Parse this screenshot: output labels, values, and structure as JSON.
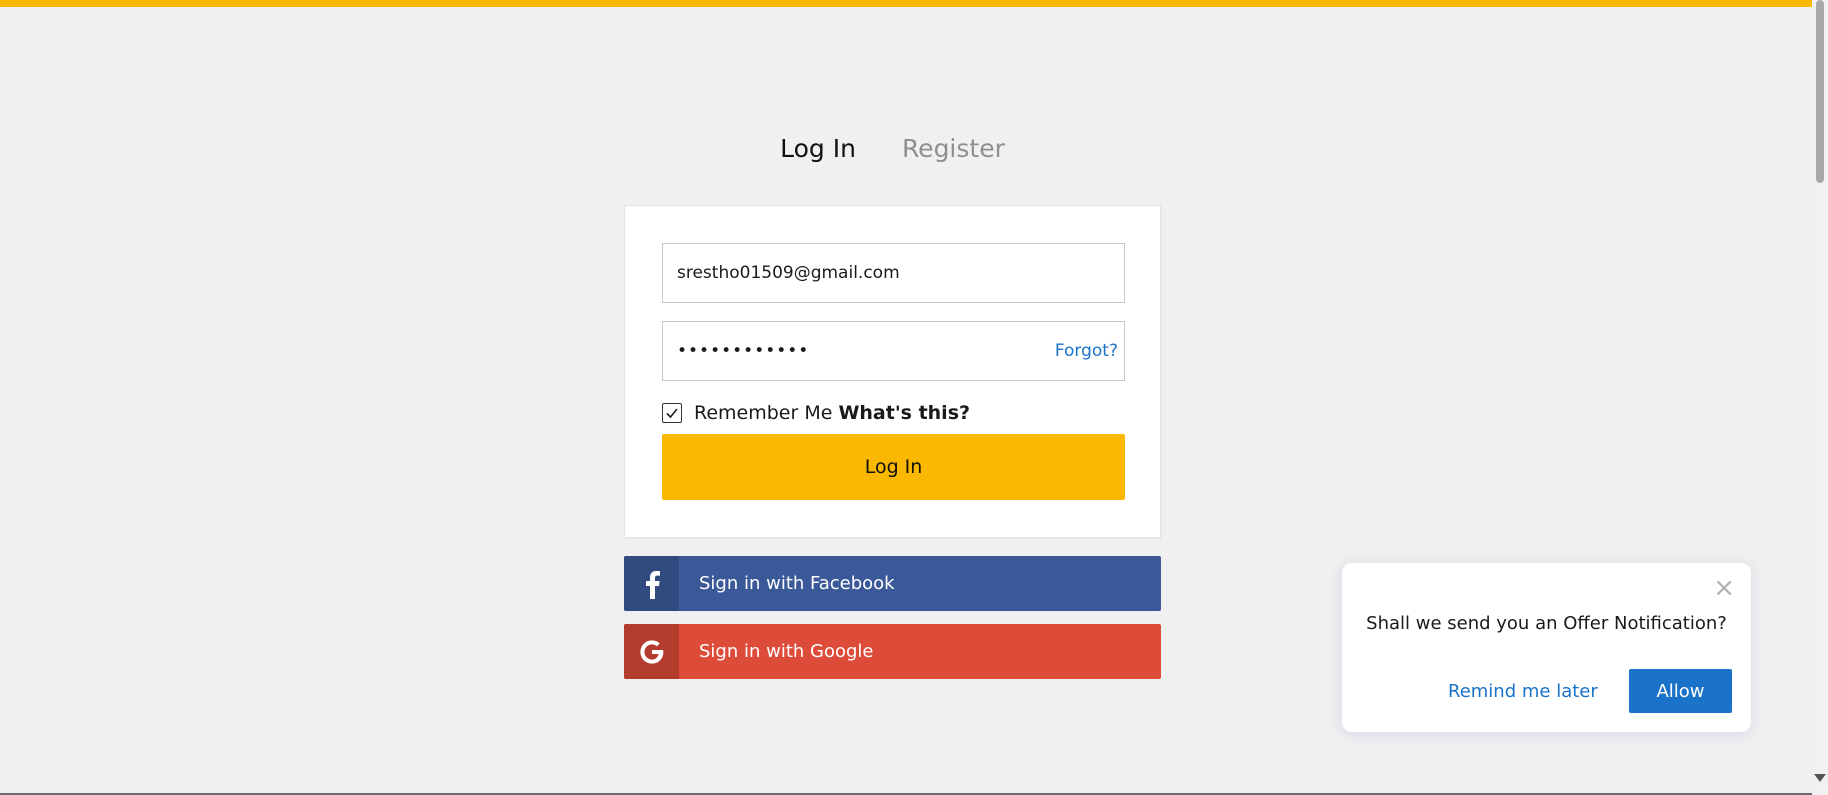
{
  "tabs": {
    "login_label": "Log In",
    "register_label": "Register"
  },
  "form": {
    "email_value": "srestho01509@gmail.com",
    "password_masked": "••••••••••••",
    "forgot_label": "Forgot?",
    "remember_label": "Remember Me",
    "remember_checked": true,
    "whats_this_label": "What's this?",
    "login_button_label": "Log In"
  },
  "social": {
    "facebook_label": "Sign in with Facebook",
    "google_label": "Sign in with Google",
    "facebook_icon": "f",
    "google_icon": "G"
  },
  "notification": {
    "close_icon": "×",
    "message": "Shall we send you an Offer Notification?",
    "remind_label": "Remind me later",
    "allow_label": "Allow"
  },
  "colors": {
    "accent": "#fbb800",
    "facebook": "#3b5999",
    "google": "#dd4b39",
    "link": "#1a73c8"
  }
}
